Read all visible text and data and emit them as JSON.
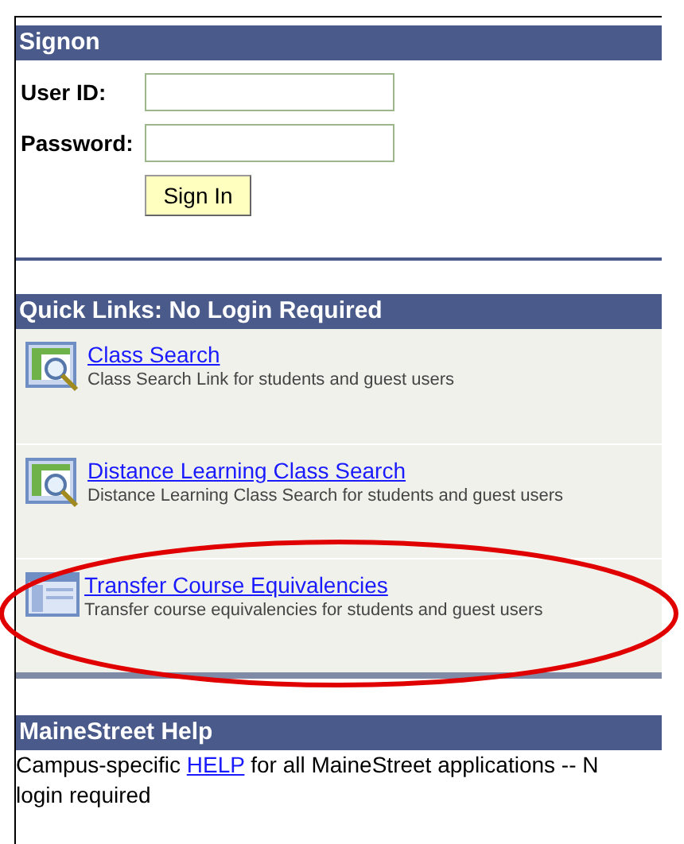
{
  "signon": {
    "title": "Signon",
    "fields": [
      {
        "label": "User ID:"
      },
      {
        "label": "Password:"
      }
    ],
    "button": "Sign In"
  },
  "quick_links": {
    "title": "Quick Links: No Login Required",
    "items": [
      {
        "kind": "search",
        "title": "Class Search",
        "description": "Class Search Link for students and guest users"
      },
      {
        "kind": "search",
        "title": "Distance Learning Class Search",
        "description": "Distance Learning Class Search for students and guest users"
      },
      {
        "kind": "page",
        "title": "Transfer Course Equivalencies",
        "description": "Transfer course equivalencies for students and guest users"
      }
    ]
  },
  "help": {
    "title": "MaineStreet Help",
    "before": "Campus-specific ",
    "link": "HELP",
    "after": " for all MaineStreet applications -- N",
    "continuation": "login required"
  }
}
